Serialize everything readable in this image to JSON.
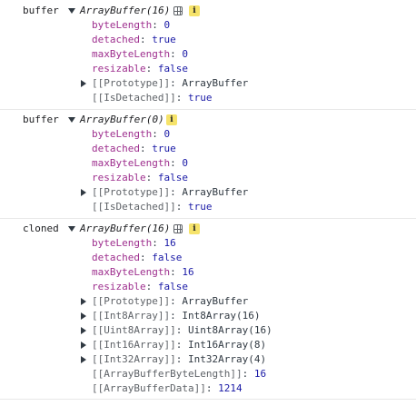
{
  "entries": [
    {
      "var": "buffer",
      "header": "ArrayBuffer(16)",
      "info": "i",
      "props": [
        {
          "key": "byteLength",
          "value": "0"
        },
        {
          "key": "detached",
          "value": "true"
        },
        {
          "key": "maxByteLength",
          "value": "0"
        },
        {
          "key": "resizable",
          "value": "false"
        }
      ],
      "prototype": {
        "key": "[[Prototype]]",
        "value": "ArrayBuffer"
      },
      "internal": [
        {
          "key": "[[IsDetached]]",
          "value": "true"
        }
      ]
    },
    {
      "var": "buffer",
      "header": "ArrayBuffer(0)",
      "info": "i",
      "props": [
        {
          "key": "byteLength",
          "value": "0"
        },
        {
          "key": "detached",
          "value": "true"
        },
        {
          "key": "maxByteLength",
          "value": "0"
        },
        {
          "key": "resizable",
          "value": "false"
        }
      ],
      "prototype": {
        "key": "[[Prototype]]",
        "value": "ArrayBuffer"
      },
      "internal": [
        {
          "key": "[[IsDetached]]",
          "value": "true"
        }
      ]
    },
    {
      "var": "cloned",
      "header": "ArrayBuffer(16)",
      "info": "i",
      "props": [
        {
          "key": "byteLength",
          "value": "16"
        },
        {
          "key": "detached",
          "value": "false"
        },
        {
          "key": "maxByteLength",
          "value": "16"
        },
        {
          "key": "resizable",
          "value": "false"
        }
      ],
      "prototype": {
        "key": "[[Prototype]]",
        "value": "ArrayBuffer"
      },
      "views": [
        {
          "key": "[[Int8Array]]",
          "value": "Int8Array(16)"
        },
        {
          "key": "[[Uint8Array]]",
          "value": "Uint8Array(16)"
        },
        {
          "key": "[[Int16Array]]",
          "value": "Int16Array(8)"
        },
        {
          "key": "[[Int32Array]]",
          "value": "Int32Array(4)"
        }
      ],
      "internal": [
        {
          "key": "[[ArrayBufferByteLength]]",
          "value": "16"
        },
        {
          "key": "[[ArrayBufferData]]",
          "value": "1214"
        }
      ]
    }
  ]
}
